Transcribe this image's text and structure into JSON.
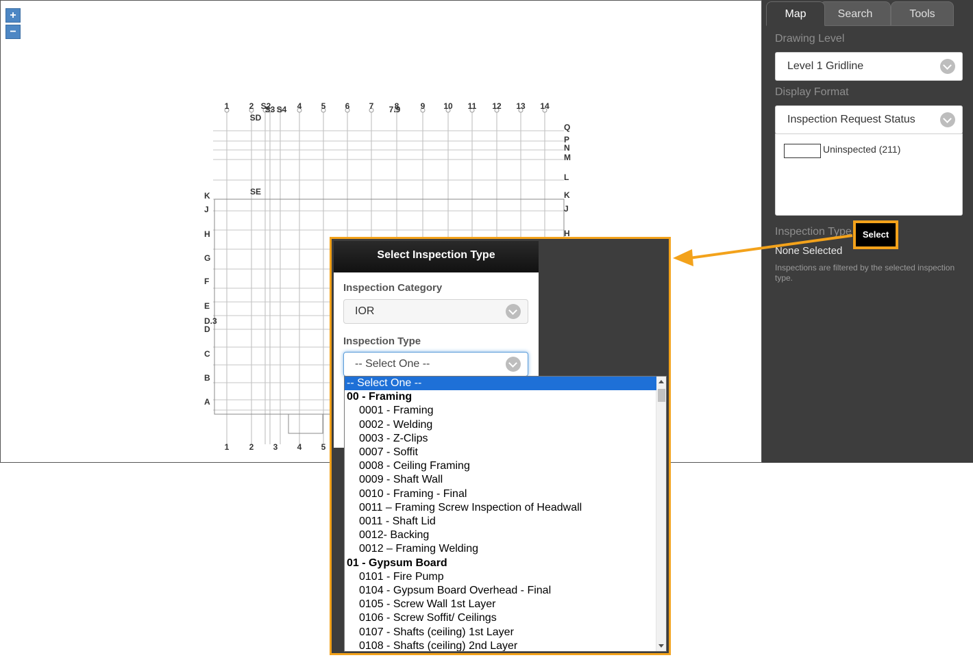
{
  "map": {
    "zoom_in": "+",
    "zoom_out": "−",
    "columns_top": [
      "1",
      "2",
      "S2",
      "S3",
      "S4",
      "4",
      "5",
      "6",
      "7",
      "8",
      "7.9",
      "9",
      "10",
      "11",
      "12",
      "13",
      "14",
      "SD",
      "SE"
    ],
    "columns_bottom": [
      "1",
      "2",
      "3",
      "4",
      "5"
    ],
    "rows_right": [
      "Q",
      "P",
      "N",
      "M",
      "L",
      "K",
      "J",
      "H"
    ],
    "rows_left": [
      "K",
      "J",
      "H",
      "G",
      "F",
      "E",
      "D",
      "D.3",
      "C",
      "B",
      "A"
    ]
  },
  "panel": {
    "tabs": [
      "Map",
      "Search",
      "Tools"
    ],
    "drawing_level_label": "Drawing Level",
    "drawing_level_value": "Level 1 Gridline",
    "display_format_label": "Display Format",
    "display_format_value": "Inspection Request Status",
    "legend_item": "Uninspected (211)",
    "inspection_type_label": "Inspection Type",
    "select_button": "Select",
    "none_selected": "None Selected",
    "note": "Inspections are filtered by the selected inspection type."
  },
  "dialog": {
    "title": "Select Inspection Type",
    "category_label": "Inspection Category",
    "category_value": "IOR",
    "type_label": "Inspection Type",
    "type_value": "-- Select One --"
  },
  "dropdown_options": [
    {
      "text": "-- Select One --",
      "kind": "selected"
    },
    {
      "text": "00 - Framing",
      "kind": "group"
    },
    {
      "text": "0001 - Framing",
      "kind": "sub"
    },
    {
      "text": "0002 - Welding",
      "kind": "sub"
    },
    {
      "text": "0003 - Z-Clips",
      "kind": "sub"
    },
    {
      "text": "0007 - Soffit",
      "kind": "sub"
    },
    {
      "text": "0008 - Ceiling Framing",
      "kind": "sub"
    },
    {
      "text": "0009 - Shaft Wall",
      "kind": "sub"
    },
    {
      "text": "0010 - Framing - Final",
      "kind": "sub"
    },
    {
      "text": "0011 – Framing Screw Inspection of Headwall",
      "kind": "sub"
    },
    {
      "text": "0011 - Shaft Lid",
      "kind": "sub"
    },
    {
      "text": "0012- Backing",
      "kind": "sub"
    },
    {
      "text": "0012 – Framing Welding",
      "kind": "sub"
    },
    {
      "text": "01 - Gypsum Board",
      "kind": "group"
    },
    {
      "text": "0101 - Fire Pump",
      "kind": "sub"
    },
    {
      "text": "0104 - Gypsum Board Overhead - Final",
      "kind": "sub"
    },
    {
      "text": "0105 - Screw Wall 1st Layer",
      "kind": "sub"
    },
    {
      "text": "0106 - Screw Soffit/ Ceilings",
      "kind": "sub"
    },
    {
      "text": "0107 - Shafts (ceiling) 1st Layer",
      "kind": "sub"
    },
    {
      "text": "0108 - Shafts (ceiling) 2nd Layer",
      "kind": "sub"
    }
  ],
  "colors": {
    "panel_bg": "#3d3d3d",
    "highlight": "#f3a21b",
    "selected_option": "#1e70d7",
    "zoom_button": "#4d87c4"
  }
}
